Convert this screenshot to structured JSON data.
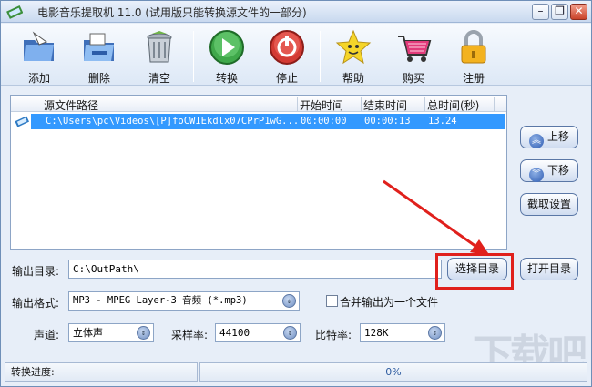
{
  "window": {
    "title": "电影音乐提取机 11.0 (试用版只能转换源文件的一部分)",
    "min_label": "–",
    "restore_label": "❐",
    "close_label": "✕"
  },
  "toolbar": {
    "items": [
      {
        "label": "添加",
        "icon": "folder-add-icon"
      },
      {
        "label": "删除",
        "icon": "folder-delete-icon"
      },
      {
        "label": "清空",
        "icon": "trash-icon"
      },
      {
        "label": "转换",
        "icon": "play-icon"
      },
      {
        "label": "停止",
        "icon": "stop-icon"
      },
      {
        "label": "帮助",
        "icon": "help-star-icon"
      },
      {
        "label": "购买",
        "icon": "cart-icon"
      },
      {
        "label": "注册",
        "icon": "lock-icon"
      }
    ]
  },
  "file_list": {
    "columns": [
      "源文件路径",
      "开始时间",
      "结束时间",
      "总时间(秒)"
    ],
    "rows": [
      {
        "path": "C:\\Users\\pc\\Videos\\[P]foCWIEkdlx07CPrP1wG...",
        "start": "00:00:00",
        "end": "00:00:13",
        "total": "13.24",
        "selected": true
      }
    ]
  },
  "side_buttons": {
    "up": "上移",
    "down": "下移",
    "settings": "截取设置"
  },
  "output": {
    "dir_label": "输出目录:",
    "dir_value": "C:\\OutPath\\",
    "choose_dir": "选择目录",
    "open_dir": "打开目录",
    "format_label": "输出格式:",
    "format_value": "MP3 - MPEG Layer-3 音频 (*.mp3)",
    "merge_label": "合并输出为一个文件",
    "merge_checked": false,
    "channel_label": "声道:",
    "channel_value": "立体声",
    "samplerate_label": "采样率:",
    "samplerate_value": "44100",
    "bitrate_label": "比特率:",
    "bitrate_value": "128K"
  },
  "status": {
    "progress_label": "转换进度:",
    "progress_text": "0%",
    "progress": 0
  },
  "colors": {
    "accent": "#3399ff",
    "highlight": "#e0201c"
  }
}
